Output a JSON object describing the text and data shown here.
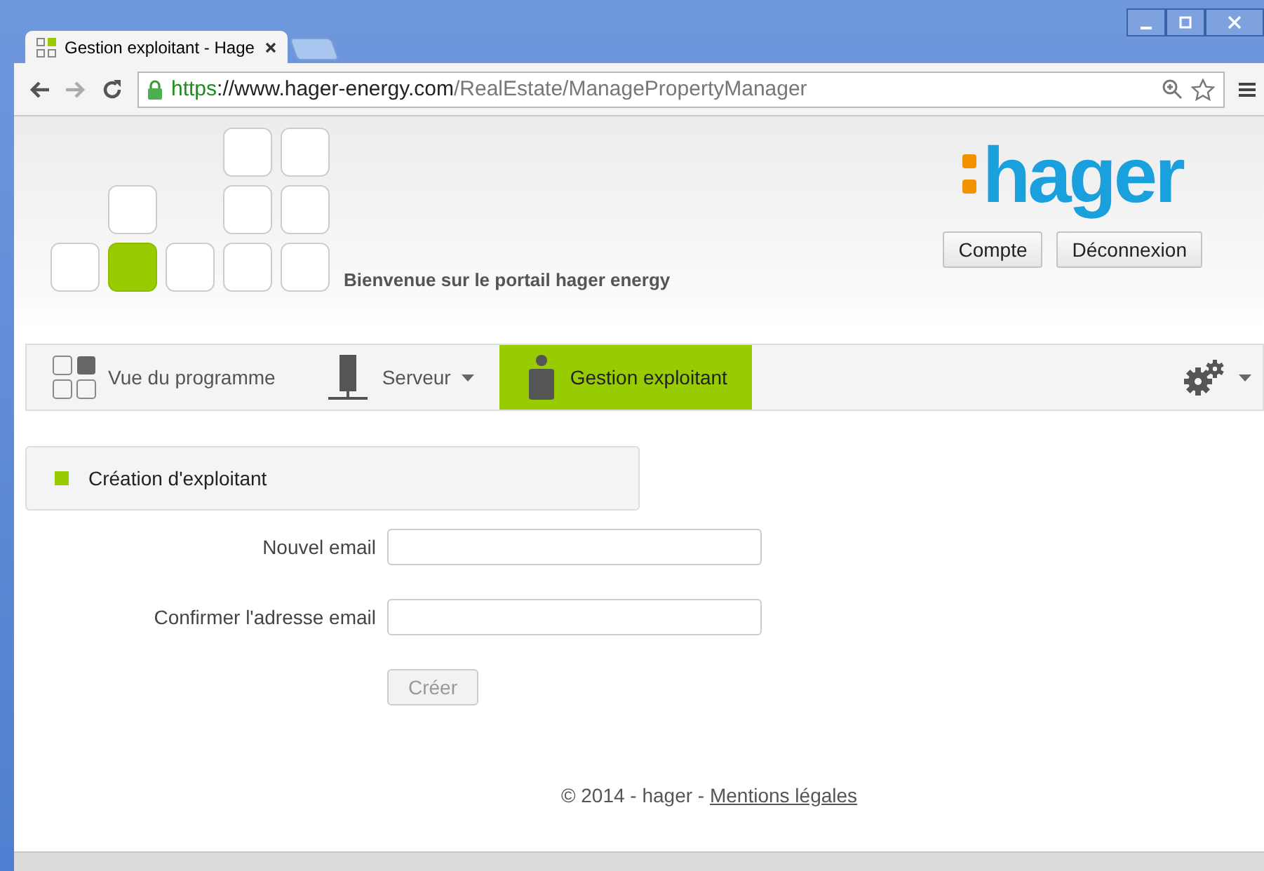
{
  "browser": {
    "tab_title": "Gestion exploitant - Hage",
    "url_scheme": "https",
    "url_host": "://www.hager-energy.com",
    "url_path": "/RealEstate/ManagePropertyManager"
  },
  "header": {
    "welcome": "Bienvenue sur le portail hager energy",
    "logo_text": "hager",
    "buttons": [
      "Compte",
      "Déconnexion"
    ]
  },
  "nav": [
    {
      "label": "Vue du programme",
      "kind": "grid",
      "dropdown": false,
      "selected": false
    },
    {
      "label": "Serveur",
      "kind": "server",
      "dropdown": true,
      "selected": false
    },
    {
      "label": "Gestion exploitant",
      "kind": "person",
      "dropdown": false,
      "selected": true
    }
  ],
  "section": {
    "title": "Création d'exploitant"
  },
  "form": {
    "fields": [
      {
        "label": "Nouvel email"
      },
      {
        "label": "Confirmer l'adresse email"
      }
    ],
    "submit": {
      "label": "Créer",
      "disabled": true
    }
  },
  "footer": {
    "copyright": "© 2014 - hager - ",
    "link": "Mentions légales"
  }
}
